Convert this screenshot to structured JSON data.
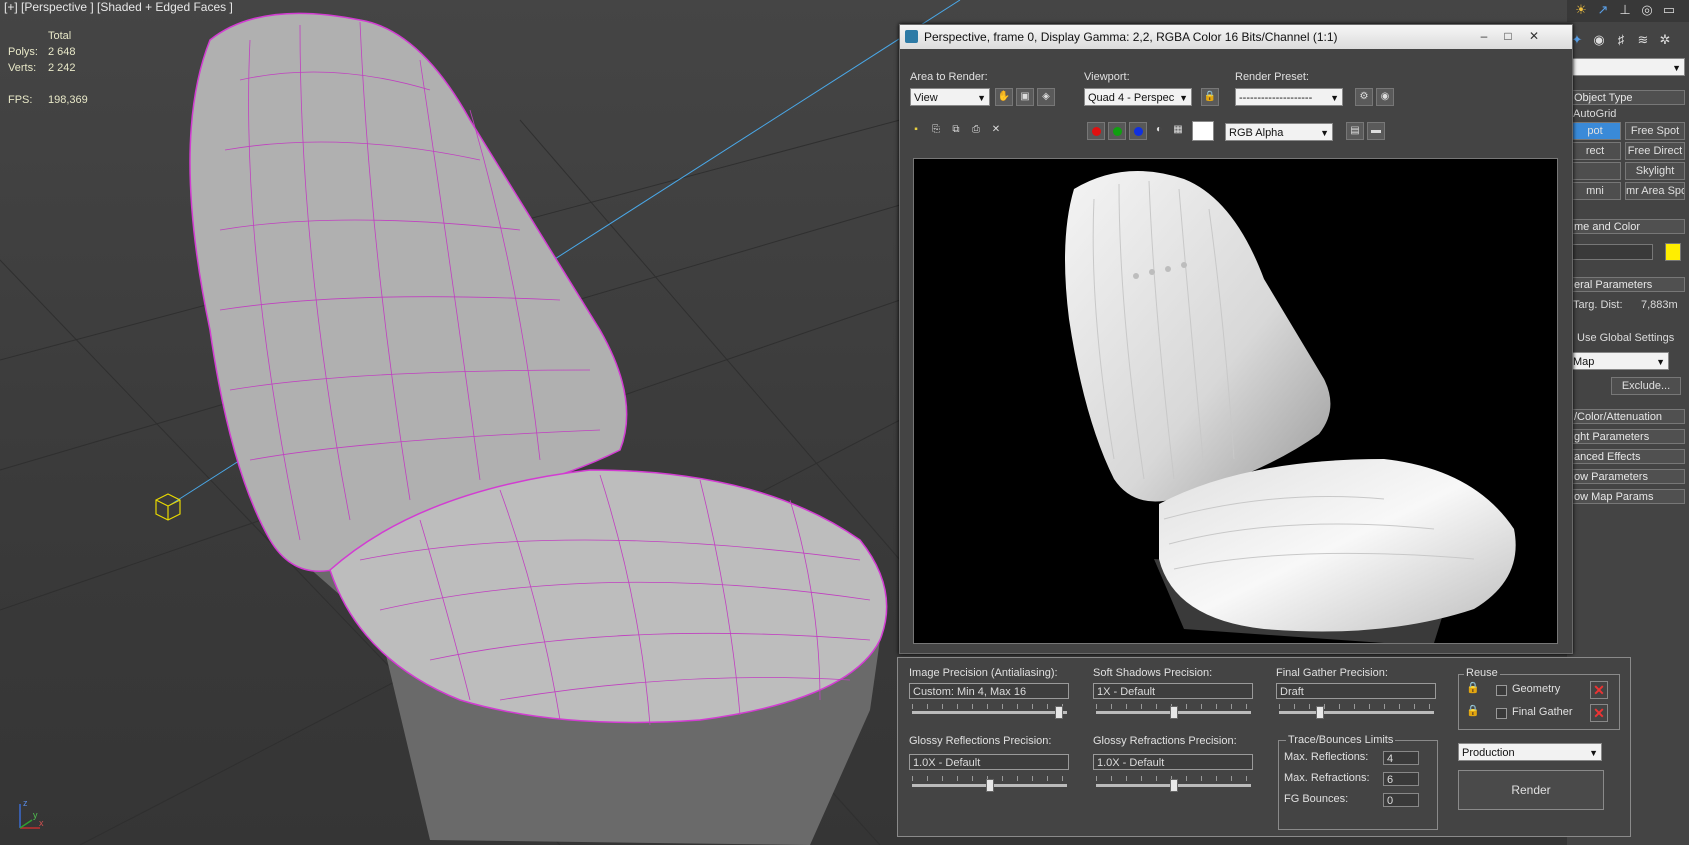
{
  "viewport": {
    "label": "[+] [Perspective ] [Shaded + Edged Faces ]",
    "stats": {
      "total_label": "Total",
      "polys_label": "Polys:",
      "polys_value": "2 648",
      "verts_label": "Verts:",
      "verts_value": "2 242",
      "fps_label": "FPS:",
      "fps_value": "198,369"
    },
    "axes": {
      "x": "x",
      "y": "y",
      "z": "z"
    }
  },
  "render_window": {
    "title": "Perspective, frame 0, Display Gamma: 2,2, RGBA Color 16 Bits/Channel (1:1)",
    "area_to_render_label": "Area to Render:",
    "area_to_render_value": "View",
    "viewport_label": "Viewport:",
    "viewport_value": "Quad 4 - Perspec",
    "render_preset_label": "Render Preset:",
    "render_preset_value": "--------------------",
    "channel_value": "RGB Alpha",
    "colors": {
      "red": "#e01010",
      "green": "#10a010",
      "blue": "#1030e0"
    }
  },
  "render_settings": {
    "image_precision_label": "Image Precision (Antialiasing):",
    "image_precision_value": "Custom: Min 4, Max 16",
    "soft_shadows_label": "Soft Shadows Precision:",
    "soft_shadows_value": "1X - Default",
    "final_gather_label": "Final Gather Precision:",
    "final_gather_value": "Draft",
    "glossy_reflections_label": "Glossy Reflections Precision:",
    "glossy_reflections_value": "1.0X - Default",
    "glossy_refractions_label": "Glossy Refractions Precision:",
    "glossy_refractions_value": "1.0X - Default",
    "trace_group_label": "Trace/Bounces Limits",
    "max_reflections_label": "Max. Reflections:",
    "max_reflections_value": "4",
    "max_refractions_label": "Max. Refractions:",
    "max_refractions_value": "6",
    "fg_bounces_label": "FG Bounces:",
    "fg_bounces_value": "0",
    "reuse_label": "Reuse",
    "geometry_label": "Geometry",
    "final_gather_reuse_label": "Final Gather",
    "mode_value": "Production",
    "render_button": "Render",
    "slider_levels": {
      "image_precision": 0.97,
      "soft_shadows": 0.5,
      "final_gather": 0.25,
      "glossy_reflections": 0.5,
      "glossy_refractions": 0.5
    }
  },
  "command_panel": {
    "object_type": "Object Type",
    "autogrid": "AutoGrid",
    "buttons": [
      "pot",
      "Free Spot",
      "rect",
      "Free Direct",
      "",
      "Skylight",
      "mni",
      "mr Area Spot"
    ],
    "name_and_color": "me and Color",
    "general_params": "eral Parameters",
    "targ_dist_label": "Targ. Dist:",
    "targ_dist_value": "7,883m",
    "use_global": "Use Global Settings",
    "map_value": "Map",
    "exclude": "Exclude...",
    "rollouts": [
      "/Color/Attenuation",
      "ght Parameters",
      "anced Effects",
      "ow Parameters",
      "ow Map Params"
    ],
    "light_color": "#ffee00"
  }
}
